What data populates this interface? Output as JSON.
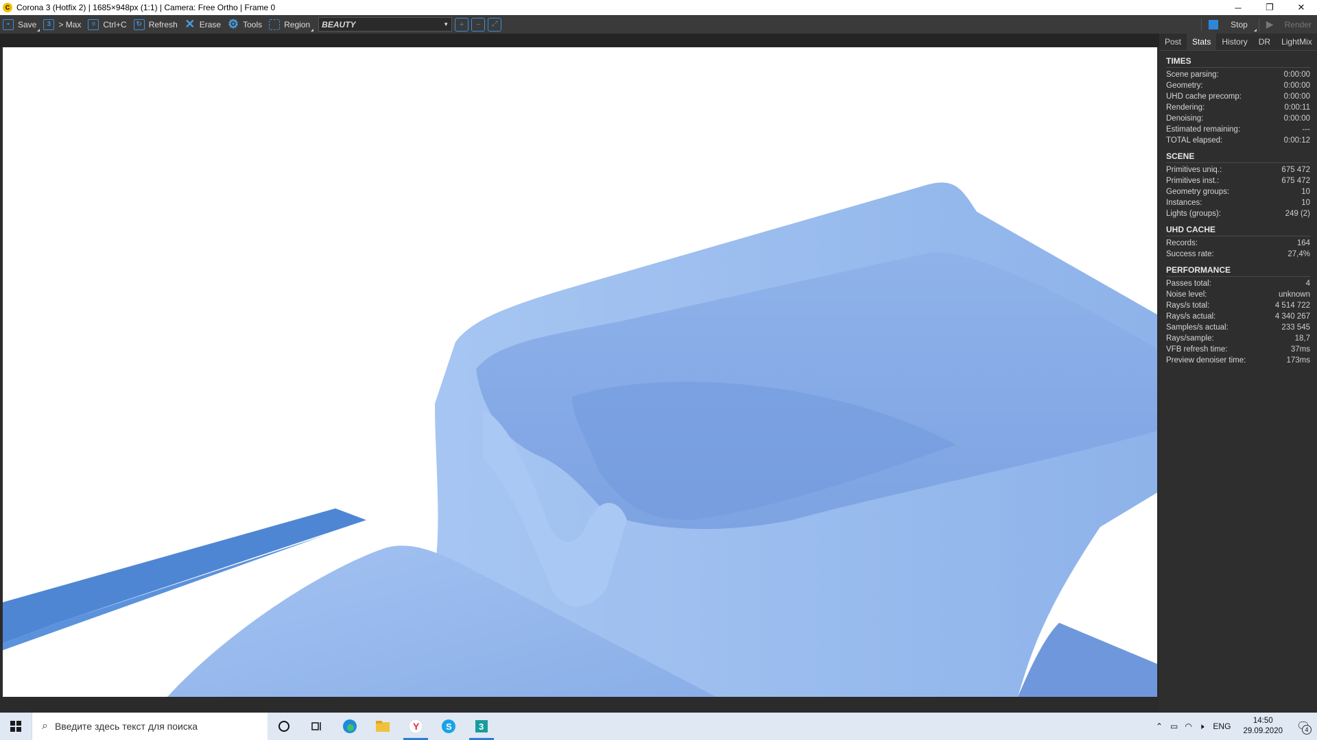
{
  "window": {
    "title": "Corona 3 (Hotfix 2) | 1685×948px (1:1) | Camera: Free Ortho | Frame 0",
    "app_icon": "corona-icon",
    "controls": {
      "minimize": "─",
      "restore": "❐",
      "close": "✕"
    }
  },
  "toolbar": {
    "save": "Save",
    "to_max": "> Max",
    "copy": "Ctrl+C",
    "refresh": "Refresh",
    "erase": "Erase",
    "tools": "Tools",
    "region": "Region",
    "pass": "BEAUTY",
    "stop": "Stop",
    "render": "Render",
    "accent_color": "#3e8ed6"
  },
  "sidebar": {
    "tabs": [
      "Post",
      "Stats",
      "History",
      "DR",
      "LightMix"
    ],
    "active_tab": "Stats",
    "times": {
      "heading": "TIMES",
      "rows": [
        {
          "label": "Scene parsing:",
          "value": "0:00:00"
        },
        {
          "label": "Geometry:",
          "value": "0:00:00"
        },
        {
          "label": "UHD cache precomp:",
          "value": "0:00:00"
        },
        {
          "label": "Rendering:",
          "value": "0:00:11"
        },
        {
          "label": "Denoising:",
          "value": "0:00:00"
        },
        {
          "label": "Estimated remaining:",
          "value": "---"
        },
        {
          "label": "TOTAL elapsed:",
          "value": "0:00:12"
        }
      ]
    },
    "scene": {
      "heading": "SCENE",
      "rows": [
        {
          "label": "Primitives uniq.:",
          "value": "675 472"
        },
        {
          "label": "Primitives inst.:",
          "value": "675 472"
        },
        {
          "label": "Geometry groups:",
          "value": "10"
        },
        {
          "label": "Instances:",
          "value": "10"
        },
        {
          "label": "Lights (groups):",
          "value": "249 (2)"
        }
      ]
    },
    "uhd": {
      "heading": "UHD CACHE",
      "rows": [
        {
          "label": "Records:",
          "value": "164"
        },
        {
          "label": "Success rate:",
          "value": "27,4%"
        }
      ]
    },
    "performance": {
      "heading": "PERFORMANCE",
      "rows": [
        {
          "label": "Passes total:",
          "value": "4"
        },
        {
          "label": "Noise level:",
          "value": "unknown"
        },
        {
          "label": "Rays/s total:",
          "value": "4 514 722"
        },
        {
          "label": "Rays/s actual:",
          "value": "4 340 267"
        },
        {
          "label": "Samples/s actual:",
          "value": "233 545"
        },
        {
          "label": "Rays/sample:",
          "value": "18,7"
        },
        {
          "label": "VFB refresh time:",
          "value": "37ms"
        },
        {
          "label": "Preview denoiser time:",
          "value": "173ms"
        }
      ]
    }
  },
  "taskbar": {
    "search_placeholder": "Введите здесь текст для поиска",
    "lang": "ENG",
    "time": "14:50",
    "date": "29.09.2020",
    "notifications": "4",
    "apps": [
      "cortana-icon",
      "task-view-icon",
      "edge-icon",
      "file-explorer-icon",
      "yandex-browser-icon",
      "skype-icon",
      "3dsmax-icon"
    ]
  },
  "render": {
    "object_color": "#9bbcec",
    "shadow_color": "#6e95d8",
    "dark_bar_color": "#4f86d4"
  }
}
